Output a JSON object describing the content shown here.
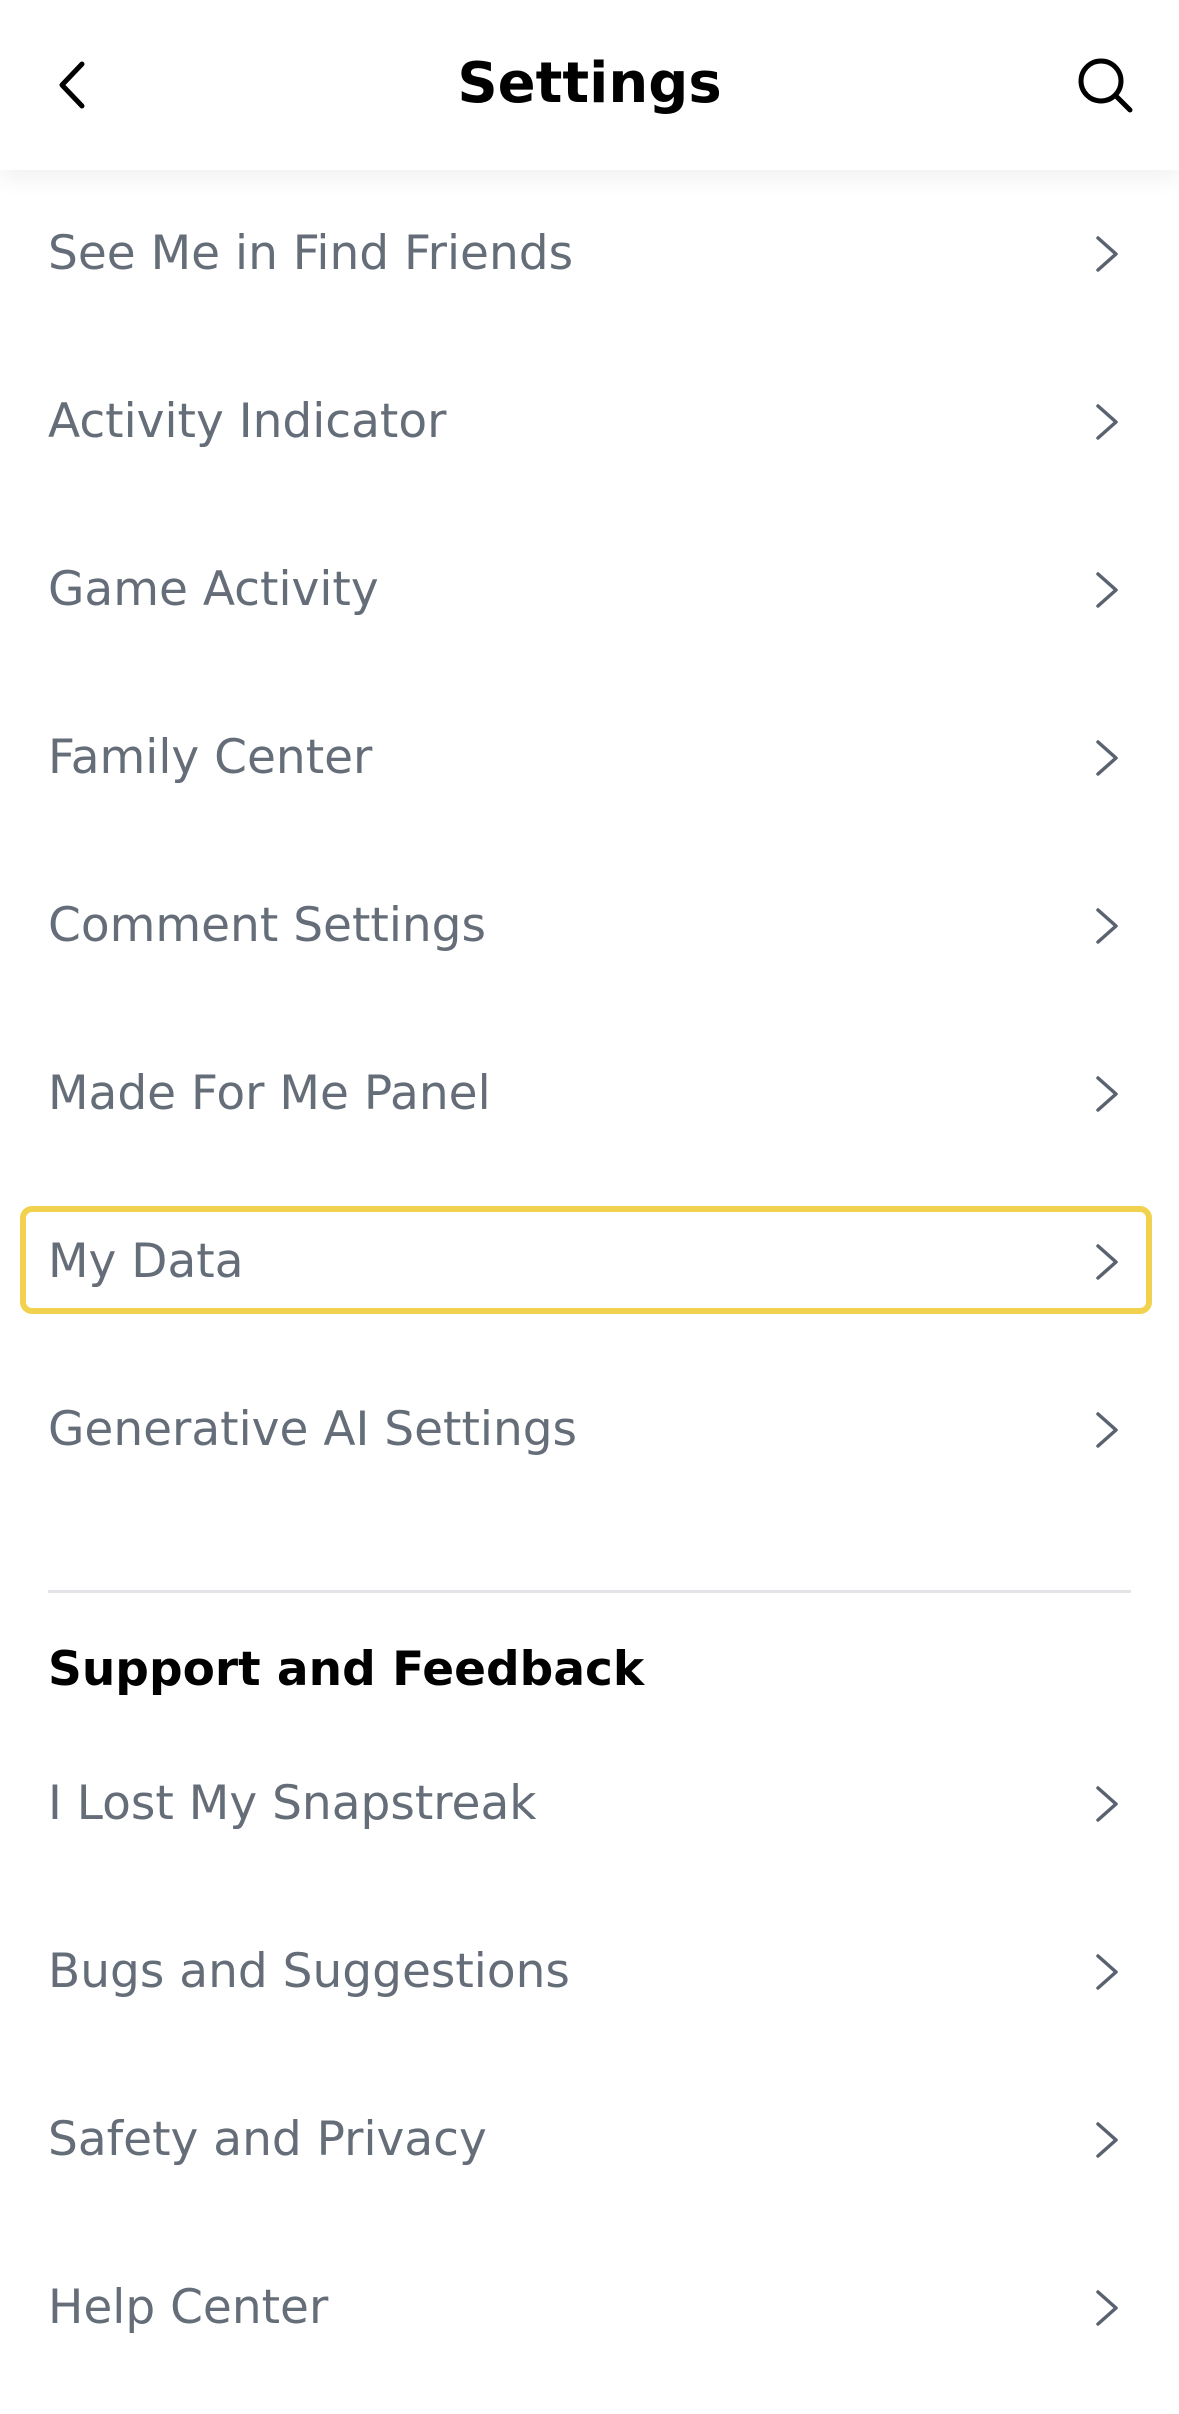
{
  "header": {
    "title": "Settings",
    "back_icon": "chevron-left-icon",
    "search_icon": "search-icon"
  },
  "privacy_items": [
    {
      "label": "See Me in Find Friends"
    },
    {
      "label": "Activity Indicator"
    },
    {
      "label": "Game Activity"
    },
    {
      "label": "Family Center"
    },
    {
      "label": "Comment Settings"
    },
    {
      "label": "Made For Me Panel"
    },
    {
      "label": "My Data",
      "highlighted": true
    },
    {
      "label": "Generative AI Settings"
    }
  ],
  "support_section": {
    "title": "Support and Feedback",
    "items": [
      {
        "label": "I Lost My Snapstreak"
      },
      {
        "label": "Bugs and Suggestions"
      },
      {
        "label": "Safety and Privacy"
      },
      {
        "label": "Help Center"
      }
    ]
  },
  "colors": {
    "item_text": "#656d78",
    "highlight_border": "#f2d14e",
    "divider": "#e2e4e8"
  }
}
